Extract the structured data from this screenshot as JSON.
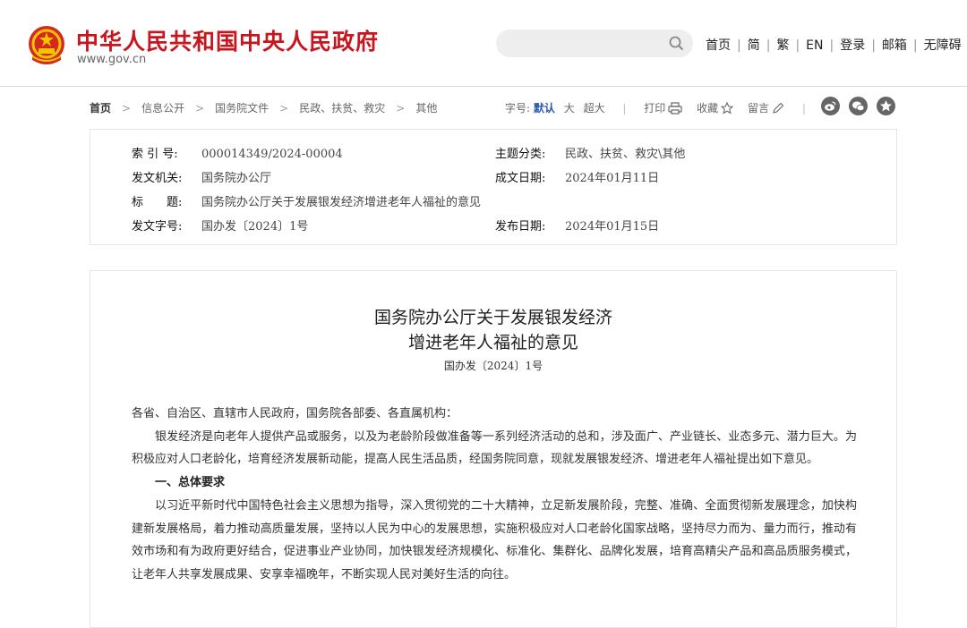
{
  "header": {
    "site_title": "中华人民共和国中央人民政府",
    "site_url": "www.gov.cn",
    "search_placeholder": "",
    "nav": [
      "首页",
      "简",
      "繁",
      "EN",
      "登录",
      "邮箱",
      "无障碍"
    ]
  },
  "breadcrumb": [
    "首页",
    "信息公开",
    "国务院文件",
    "民政、扶贫、救灾",
    "其他"
  ],
  "tools": {
    "font_size_label": "字号:",
    "font_default": "默认",
    "font_large": "大",
    "font_xlarge": "超大",
    "print": "打印",
    "favorite": "收藏",
    "comment": "留言"
  },
  "share_icons": [
    "weibo-icon",
    "wechat-icon",
    "star-icon"
  ],
  "meta": {
    "index_label": "索 引 号:",
    "index_value": "000014349/2024-00004",
    "category_label": "主题分类:",
    "category_value": "民政、扶贫、救灾\\其他",
    "issuer_label": "发文机关:",
    "issuer_value": "国务院办公厅",
    "written_label": "成文日期:",
    "written_value": "2024年01月11日",
    "title_label": "标　　题:",
    "title_value": "国务院办公厅关于发展银发经济增进老年人福祉的意见",
    "docnum_label": "发文字号:",
    "docnum_value": "国办发〔2024〕1号",
    "published_label": "发布日期:",
    "published_value": "2024年01月15日"
  },
  "document": {
    "title_line1": "国务院办公厅关于发展银发经济",
    "title_line2": "增进老年人福祉的意见",
    "doc_number": "国办发〔2024〕1号",
    "addressee": "各省、自治区、直辖市人民政府，国务院各部委、各直属机构：",
    "para1": "银发经济是向老年人提供产品或服务，以及为老龄阶段做准备等一系列经济活动的总和，涉及面广、产业链长、业态多元、潜力巨大。为积极应对人口老龄化，培育经济发展新动能，提高人民生活品质，经国务院同意，现就发展银发经济、增进老年人福祉提出如下意见。",
    "heading1": "一、总体要求",
    "para2": "以习近平新时代中国特色社会主义思想为指导，深入贯彻党的二十大精神，立足新发展阶段，完整、准确、全面贯彻新发展理念，加快构建新发展格局，着力推动高质量发展，坚持以人民为中心的发展思想，实施积极应对人口老龄化国家战略，坚持尽力而为、量力而行，推动有效市场和有为政府更好结合，促进事业产业协同，加快银发经济规模化、标准化、集群化、品牌化发展，培育高精尖产品和高品质服务模式，让老年人共享发展成果、安享幸福晚年，不断实现人民对美好生活的向往。"
  },
  "colors": {
    "brand_red": "#c8161e",
    "link_blue": "#2a5aa8",
    "border": "#e6e6e6"
  }
}
